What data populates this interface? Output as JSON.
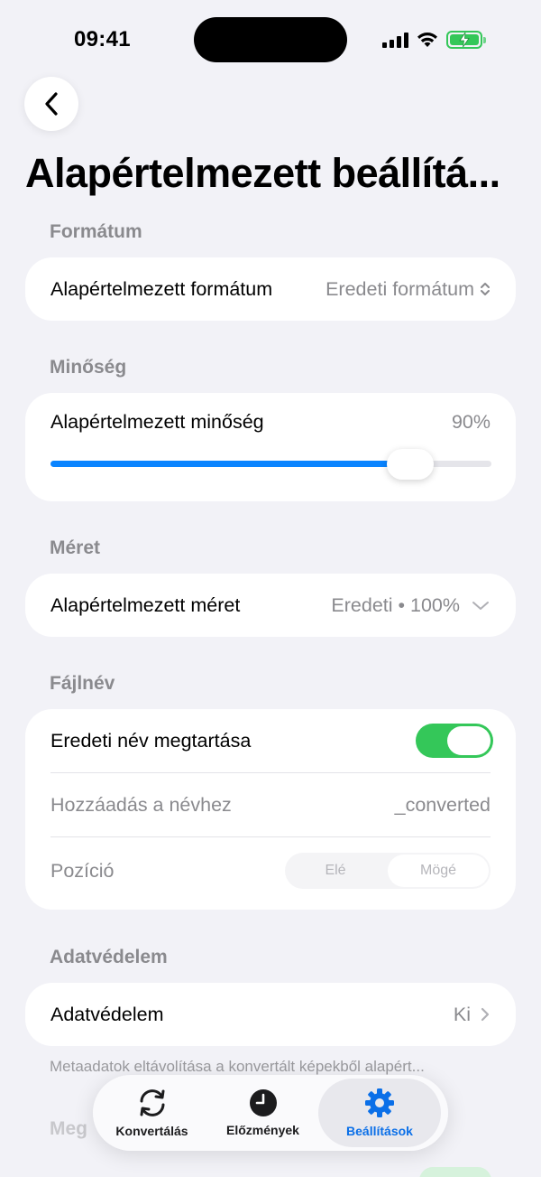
{
  "status_bar": {
    "time": "09:41"
  },
  "page": {
    "title": "Alapértelmezett beállítá..."
  },
  "sections": {
    "format": {
      "header": "Formátum",
      "row_label": "Alapértelmezett formátum",
      "row_value": "Eredeti formátum"
    },
    "quality": {
      "header": "Minőség",
      "row_label": "Alapértelmezett minőség",
      "value_text": "90%",
      "slider_fraction": 0.8
    },
    "size": {
      "header": "Méret",
      "row_label": "Alapértelmezett méret",
      "row_value": "Eredeti • 100%"
    },
    "filename": {
      "header": "Fájlnév",
      "keep_name_label": "Eredeti név megtartása",
      "keep_name_on": true,
      "append_label": "Hozzáadás a névhez",
      "append_value": "_converted",
      "position_label": "Pozíció",
      "position_options": [
        "Elé",
        "Mögé"
      ],
      "position_selected": "Mögé"
    },
    "privacy": {
      "header": "Adatvédelem",
      "row_label": "Adatvédelem",
      "row_value": "Ki",
      "footnote": "Metaadatok eltávolítása a konvertált képekből alapért..."
    },
    "next_header_partial": "Meg"
  },
  "tab_bar": {
    "tabs": [
      {
        "label": "Konvertálás",
        "icon": "arrows-cycle-icon"
      },
      {
        "label": "Előzmények",
        "icon": "clock-icon"
      },
      {
        "label": "Beállítások",
        "icon": "gear-icon"
      }
    ],
    "active": "Beállítások"
  },
  "colors": {
    "accent": "#0a84ff",
    "toggle_on": "#34c759",
    "background": "#f2f2f7",
    "secondary_text": "#8a8a8e"
  }
}
